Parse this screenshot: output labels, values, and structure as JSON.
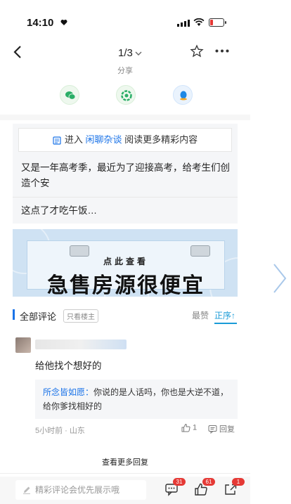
{
  "status_bar": {
    "time": "14:10"
  },
  "nav": {
    "page_indicator": "1/3"
  },
  "share": {
    "label": "分享",
    "targets": [
      "wechat-icon",
      "moments-icon",
      "qq-icon"
    ]
  },
  "banner_tip": {
    "prefix": "进入",
    "forum": "闲聊杂谈",
    "suffix": "阅读更多精彩内容"
  },
  "post": {
    "text": "又是一年高考季，最近为了迎接高考，给考生们创造个安",
    "text2": "这点了才吃午饭…"
  },
  "ad": {
    "small_text": "点此查看",
    "big_text": "急售房源很便宜"
  },
  "comments_header": {
    "all": "全部评论",
    "owner_only": "只看楼主",
    "hot": "最赞",
    "asc": "正序↑"
  },
  "comment": {
    "text": "给他找个想好的",
    "reply_name": "所念皆如愿：",
    "reply_text": "你说的是人话吗，你也是大逆不道，给你爹找相好的",
    "meta": "5小时前 · 山东",
    "likes": "1",
    "reply_label": "回复"
  },
  "more_replies": "查看更多回复",
  "bottom_bar": {
    "placeholder": "精彩评论会优先展示哦",
    "comment_badge": "31",
    "like_badge": "61",
    "share_badge": "1"
  },
  "colors": {
    "accent": "#1a73e8",
    "badge": "#e53935",
    "wechat": "#2aae67",
    "qq": "#1e88e5"
  }
}
